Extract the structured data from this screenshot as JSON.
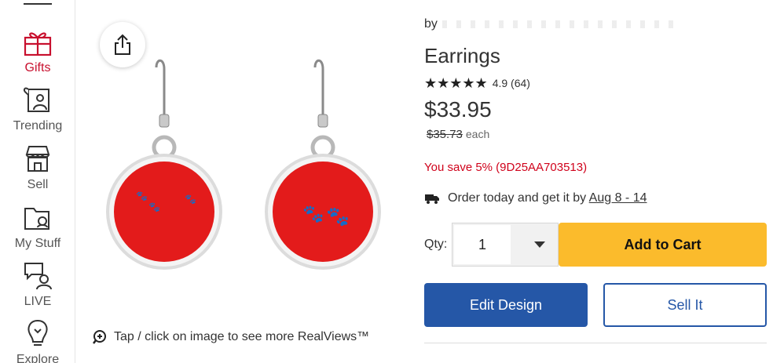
{
  "nav": {
    "items": [
      {
        "label": "Gifts",
        "icon": "gift-icon",
        "active": true
      },
      {
        "label": "Trending",
        "icon": "trending-heart-icon"
      },
      {
        "label": "Sell",
        "icon": "store-icon"
      },
      {
        "label": "My Stuff",
        "icon": "folder-icon"
      },
      {
        "label": "LIVE",
        "icon": "chat-person-icon"
      },
      {
        "label": "Explore",
        "icon": "lightbulb-icon"
      }
    ]
  },
  "gallery": {
    "share_icon": "share-icon",
    "realviews_text": "Tap / click on image to see more RealViews™"
  },
  "product": {
    "by_label": "by",
    "title": "Earrings",
    "stars": "★★★★★",
    "rating": "4.9 (64)",
    "price": "$33.95",
    "old_price": "$35.73",
    "each_label": "each",
    "savings": "You save 5% (9D25AA703513)",
    "delivery_prefix": "Order today and get it by",
    "delivery_date": "Aug 8 - 14",
    "qty_label": "Qty:",
    "qty_value": "1",
    "add_to_cart": "Add to Cart",
    "edit_design": "Edit Design",
    "sell_it": "Sell It"
  },
  "colors": {
    "brand_red": "#c8102e",
    "save_red": "#d0021b",
    "cart_yellow": "#fbbb2c",
    "primary_blue": "#2557a7",
    "earring_red": "#e31b1b"
  }
}
